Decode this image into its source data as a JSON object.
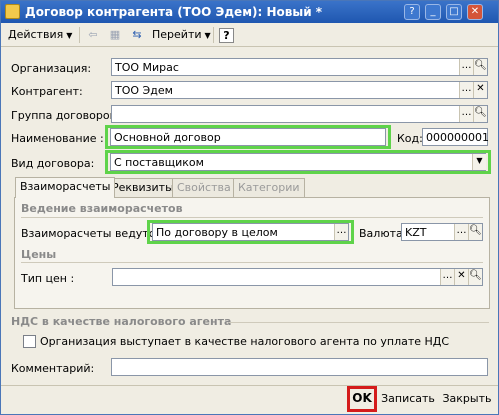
{
  "window": {
    "title": "Договор контрагента (ТОО Эдем): Новый *",
    "btn_help": "?",
    "btn_min": "_",
    "btn_max": "□",
    "btn_close": "✕"
  },
  "toolbar": {
    "actions": "Действия",
    "goto": "Перейти",
    "help": "?"
  },
  "form": {
    "org_label": "Организация:",
    "org_value": "ТОО Мирас",
    "contr_label": "Контрагент:",
    "contr_value": "ТОО Эдем",
    "group_label": "Группа договоров:",
    "group_value": "",
    "name_label": "Наименование :",
    "name_value": "Основной договор",
    "code_label": "Код:",
    "code_value": "000000001",
    "type_label": "Вид договора:",
    "type_value": "С поставщиком"
  },
  "tabs": [
    {
      "label": "Взаиморасчеты",
      "active": true
    },
    {
      "label": "Реквизиты",
      "active": false
    },
    {
      "label": "Свойства",
      "active": false
    },
    {
      "label": "Категории",
      "active": false
    }
  ],
  "settlements": {
    "section_title": "Ведение взаиморасчетов",
    "mode_label": "Взаиморасчеты ведутся:",
    "mode_value": "По договору в целом",
    "currency_label": "Валюта:",
    "currency_value": "KZT",
    "prices_title": "Цены",
    "price_type_label": "Тип цен :",
    "price_type_value": ""
  },
  "vat": {
    "section_title": "НДС в качестве налогового агента",
    "agent_checkbox_label": "Организация выступает в качестве налогового агента по уплате НДС",
    "agent_checked": false
  },
  "comment": {
    "label": "Комментарий:",
    "value": ""
  },
  "buttons": {
    "ok": "OK",
    "save": "Записать",
    "close": "Закрыть"
  },
  "colors": {
    "highlight_green": "#5fd34a",
    "highlight_red": "#d41b1b",
    "titlebar": "#2a63bd"
  }
}
